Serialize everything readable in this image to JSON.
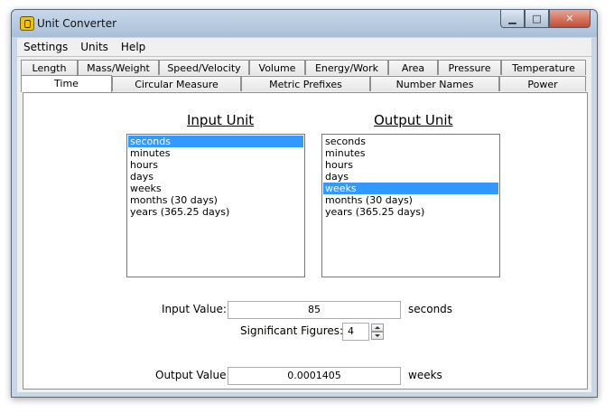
{
  "window": {
    "title": "Unit Converter"
  },
  "menu": [
    "Settings",
    "Units",
    "Help"
  ],
  "tabs_row1": [
    "Length",
    "Mass/Weight",
    "Speed/Velocity",
    "Volume",
    "Energy/Work",
    "Area",
    "Pressure",
    "Temperature"
  ],
  "tabs_row2": [
    "Time",
    "Circular Measure",
    "Metric Prefixes",
    "Number Names",
    "Power"
  ],
  "active_tab": "Time",
  "input_unit": {
    "heading": "Input Unit",
    "options": [
      "seconds",
      "minutes",
      "hours",
      "days",
      "weeks",
      "months (30 days)",
      "years (365.25 days)"
    ],
    "selected": "seconds"
  },
  "output_unit": {
    "heading": "Output Unit",
    "options": [
      "seconds",
      "minutes",
      "hours",
      "days",
      "weeks",
      "months (30 days)",
      "years (365.25 days)"
    ],
    "selected": "weeks"
  },
  "input_value": {
    "label": "Input Value:",
    "value": "85",
    "unit": "seconds"
  },
  "significant_figures": {
    "label": "Significant Figures:",
    "value": "4"
  },
  "output_value": {
    "label": "Output Value:",
    "value": "0.0001405",
    "unit": "weeks"
  },
  "colors": {
    "selection": "#3399ff",
    "titlebar": "#b4c8de",
    "close_button": "#c44b30"
  }
}
